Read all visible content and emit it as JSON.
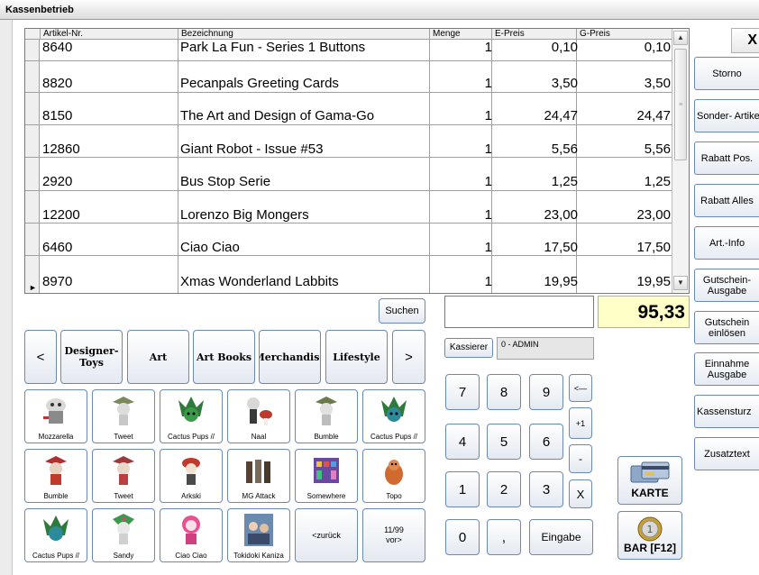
{
  "window": {
    "title": "Kassenbetrieb",
    "close_label": "X"
  },
  "grid": {
    "columns": [
      "Artikel-Nr.",
      "Bezeichnung",
      "Menge",
      "E-Preis",
      "G-Preis"
    ],
    "rows": [
      {
        "artnr": "8640",
        "name": "Park La Fun - Series 1 Buttons",
        "menge": "1",
        "epreis": "0,10",
        "gpreis": "0,10"
      },
      {
        "artnr": "8820",
        "name": "Pecanpals Greeting Cards",
        "menge": "1",
        "epreis": "3,50",
        "gpreis": "3,50"
      },
      {
        "artnr": "8150",
        "name": "The Art and Design of Gama-Go",
        "menge": "1",
        "epreis": "24,47",
        "gpreis": "24,47"
      },
      {
        "artnr": "12860",
        "name": "Giant Robot - Issue #53",
        "menge": "1",
        "epreis": "5,56",
        "gpreis": "5,56"
      },
      {
        "artnr": "2920",
        "name": "Bus Stop Serie",
        "menge": "1",
        "epreis": "1,25",
        "gpreis": "1,25"
      },
      {
        "artnr": "12200",
        "name": "Lorenzo Big Mongers",
        "menge": "1",
        "epreis": "23,00",
        "gpreis": "23,00"
      },
      {
        "artnr": "6460",
        "name": "Ciao Ciao",
        "menge": "1",
        "epreis": "17,50",
        "gpreis": "17,50"
      },
      {
        "artnr": "8970",
        "name": "Xmas Wonderland Labbits",
        "menge": "1",
        "epreis": "19,95",
        "gpreis": "19,95"
      }
    ]
  },
  "right_buttons": {
    "storno": "Storno",
    "sonder": "Sonder- Artikel",
    "rabatt_pos": "Rabatt Pos.",
    "rabatt_alles": "Rabatt Alles",
    "art_info": "Art.-Info",
    "gutschein_ausgabe": "Gutschein- Ausgabe",
    "gutschein_einloesen": "Gutschein einlösen",
    "einnahme_ausgabe": "Einnahme Ausgabe",
    "kassensturz": "Kassensturz",
    "zusatztext": "Zusatztext"
  },
  "search": {
    "label": "Suchen"
  },
  "total": "95,33",
  "kassierer": {
    "label": "Kassierer",
    "value": "0 - ADMIN"
  },
  "categories": {
    "prev": "<",
    "next": ">",
    "items": [
      "Designer-Toys",
      "Art",
      "Art Books",
      "Merchandise",
      "Lifestyle"
    ]
  },
  "products": [
    [
      "Mozzarella",
      "Tweet",
      "Cactus Pups //",
      "Naal",
      "Bumble",
      "Cactus Pups //"
    ],
    [
      "Bumble",
      "Tweet",
      "Arkski",
      "MG Attack",
      "Somewhere",
      "Topo"
    ],
    [
      "Cactus Pups //",
      "Sandy",
      "Ciao Ciao",
      "Tokidoki Kaniza"
    ]
  ],
  "paging": {
    "back": "<zurück",
    "page": "11/99",
    "forward": "vor>"
  },
  "keypad": {
    "keys": [
      "7",
      "8",
      "9",
      "4",
      "5",
      "6",
      "1",
      "2",
      "3",
      "0",
      ","
    ],
    "backspace": "<—",
    "plus_one": "+1",
    "minus": "-",
    "clear": "X",
    "enter": "Eingabe"
  },
  "payment": {
    "card": "KARTE",
    "cash": "BAR [F12]"
  },
  "colors": {
    "accent_border": "#6a8ab5",
    "total_bg": "#ffffc8"
  }
}
